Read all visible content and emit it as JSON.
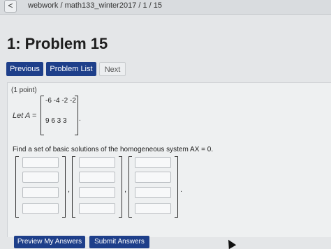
{
  "header": {
    "back_icon": "chevron-left-icon",
    "back_glyph": "<",
    "breadcrumb": "webwork / math133_winter2017 / 1 / 15"
  },
  "title": "1: Problem 15",
  "nav": {
    "previous": "Previous",
    "problem_list": "Problem List",
    "next": "Next"
  },
  "problem": {
    "points": "(1 point)",
    "let_label": "Let A =",
    "matrix_rows": [
      "-6 -4 -2 -2",
      "9  6  3  3"
    ],
    "matrix_period": ".",
    "instruction": "Find a set of basic solutions of the homogeneous system AX = 0.",
    "vectors": [
      {
        "name": "vector-1",
        "fields": [
          "",
          "",
          "",
          ""
        ]
      },
      {
        "name": "vector-2",
        "fields": [
          "",
          "",
          "",
          ""
        ]
      },
      {
        "name": "vector-3",
        "fields": [
          "",
          "",
          "",
          ""
        ]
      }
    ],
    "comma": ",",
    "end_period": "."
  },
  "actions": {
    "preview": "Preview My Answers",
    "submit": "Submit Answers"
  }
}
